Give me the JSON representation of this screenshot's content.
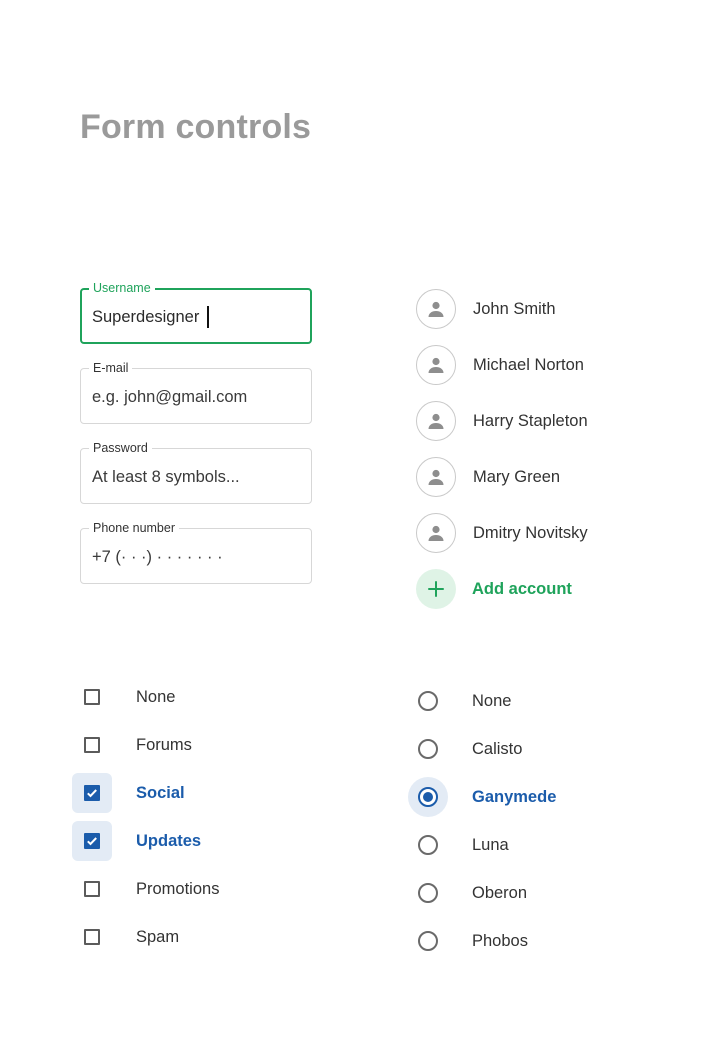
{
  "page": {
    "title": "Form controls"
  },
  "fields": {
    "username": {
      "label": "Username",
      "value": "Superdesigner",
      "placeholder": ""
    },
    "email": {
      "label": "E-mail",
      "value": "",
      "placeholder": "e.g. john@gmail.com"
    },
    "password": {
      "label": "Password",
      "value": "",
      "placeholder": "At least 8 symbols..."
    },
    "phone": {
      "label": "Phone number",
      "value": "",
      "placeholder": "+7 (· · ·) · · · · · · ·"
    }
  },
  "accounts": {
    "items": [
      {
        "name": "John Smith",
        "icon": "user-icon"
      },
      {
        "name": "Michael Norton",
        "icon": "user-icon"
      },
      {
        "name": "Harry Stapleton",
        "icon": "user-icon"
      },
      {
        "name": "Mary Green",
        "icon": "user-icon"
      },
      {
        "name": "Dmitry Novitsky",
        "icon": "user-icon"
      }
    ],
    "add_label": "Add account",
    "add_icon": "plus-icon"
  },
  "checkboxes": {
    "items": [
      {
        "label": "None",
        "checked": false
      },
      {
        "label": "Forums",
        "checked": false
      },
      {
        "label": "Social",
        "checked": true
      },
      {
        "label": "Updates",
        "checked": true
      },
      {
        "label": "Promotions",
        "checked": false
      },
      {
        "label": "Spam",
        "checked": false
      }
    ]
  },
  "radios": {
    "items": [
      {
        "label": "None",
        "selected": false
      },
      {
        "label": "Calisto",
        "selected": false
      },
      {
        "label": "Ganymede",
        "selected": true
      },
      {
        "label": "Luna",
        "selected": false
      },
      {
        "label": "Oberon",
        "selected": false
      },
      {
        "label": "Phobos",
        "selected": false
      }
    ]
  },
  "colors": {
    "accent_green": "#1fa35b",
    "accent_blue": "#1b5cab",
    "title_gray": "#9a9a9a",
    "selected_bg": "#e3ebf5",
    "add_bg": "#dff3e6"
  }
}
